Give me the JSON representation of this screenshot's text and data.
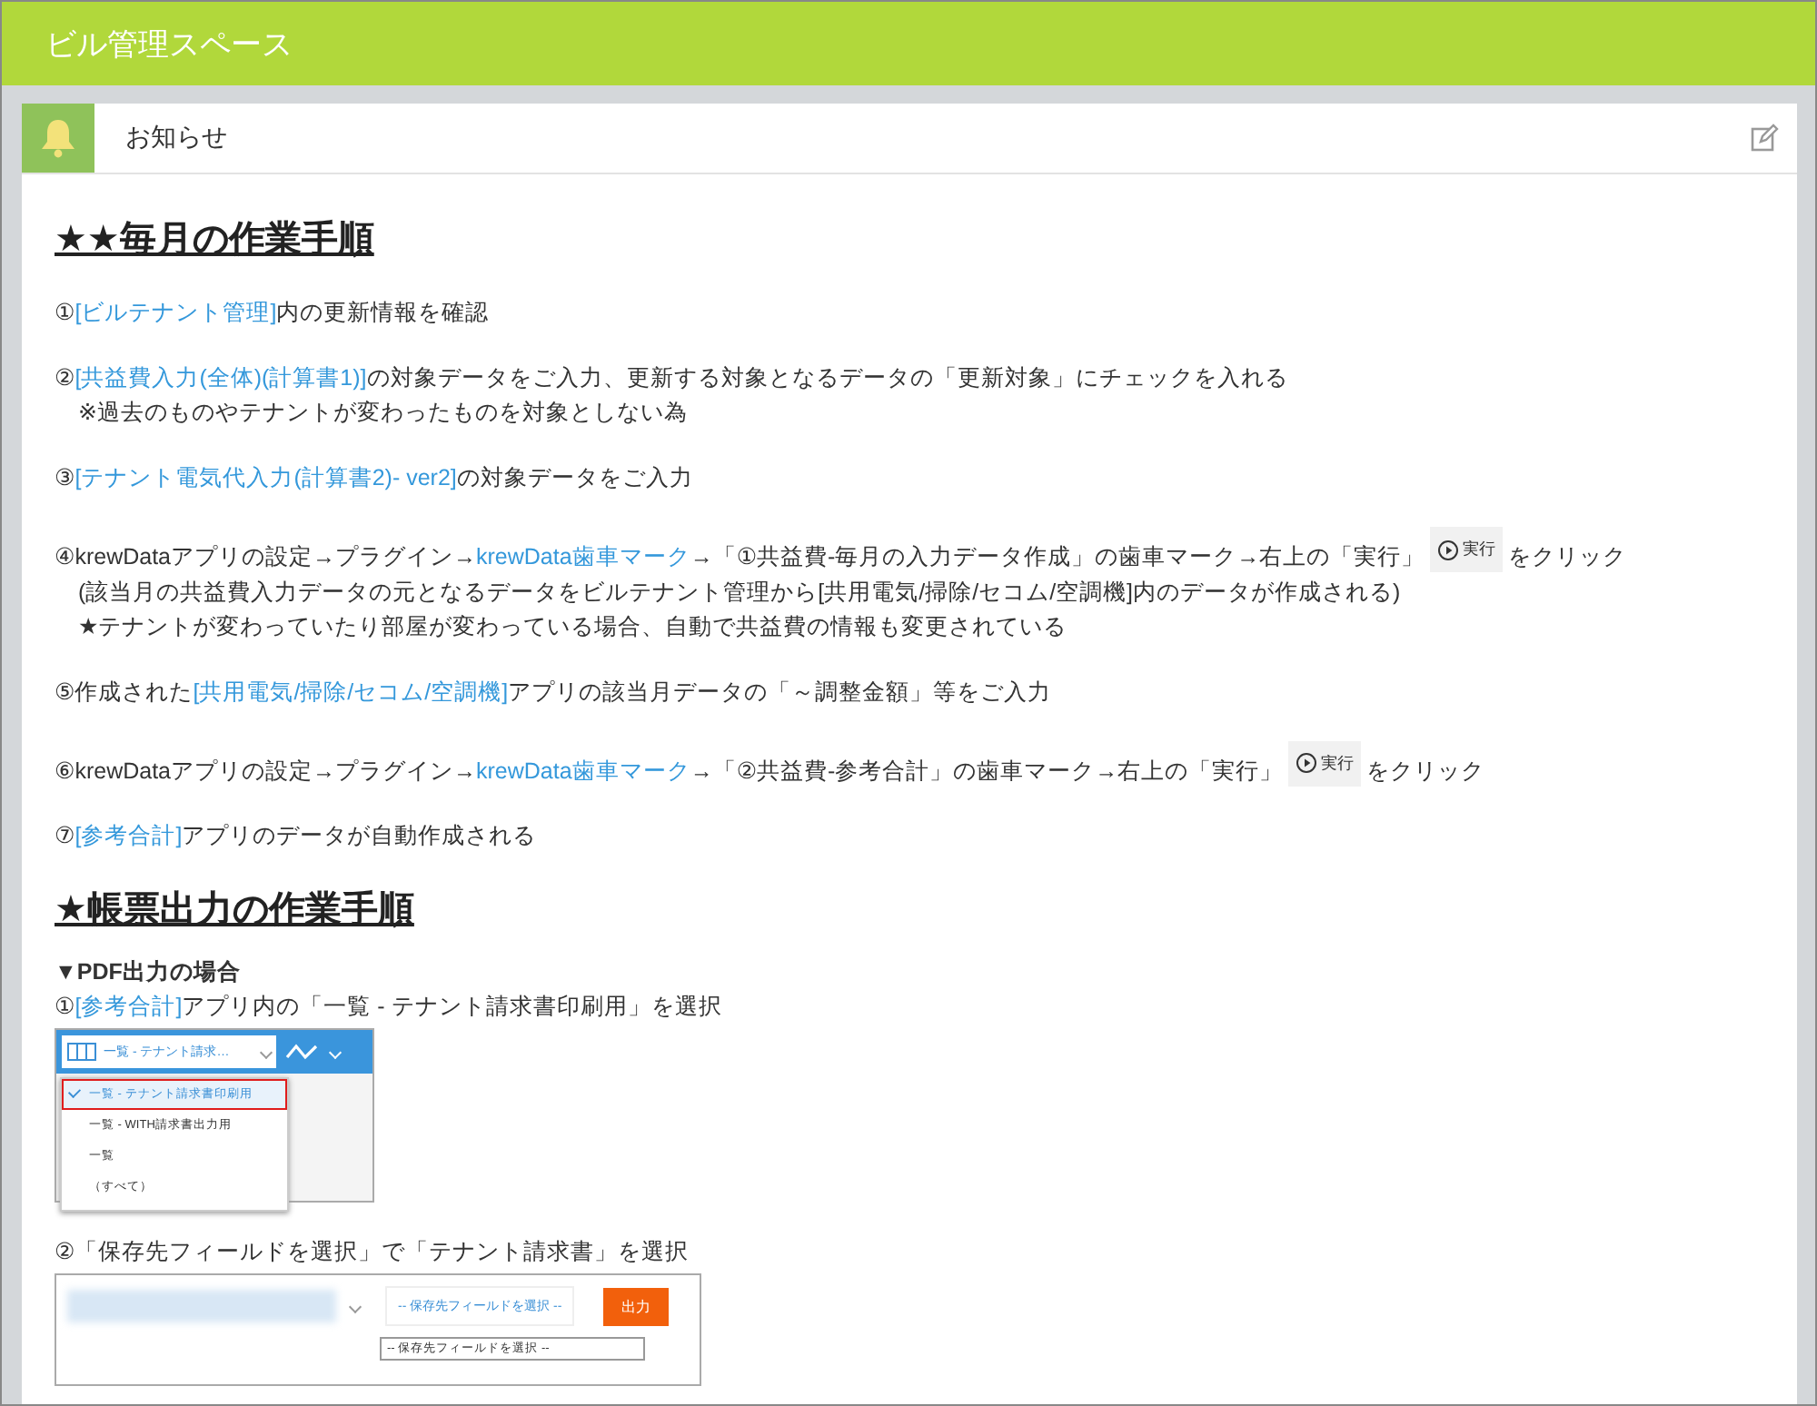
{
  "header": {
    "title": "ビル管理スペース"
  },
  "panel": {
    "title": "お知らせ"
  },
  "sections": [
    {
      "heading": "★★毎月の作業手順",
      "steps": [
        {
          "lines": [
            [
              {
                "kind": "text",
                "text": "①"
              },
              {
                "kind": "link",
                "text": "[ビルテナント管理]"
              },
              {
                "kind": "text",
                "text": "内の更新情報を確認"
              }
            ]
          ]
        },
        {
          "lines": [
            [
              {
                "kind": "text",
                "text": "②"
              },
              {
                "kind": "link",
                "text": "[共益費入力(全体)(計算書1)]"
              },
              {
                "kind": "text",
                "text": "の対象データをご入力、更新する対象となるデータの「更新対象」にチェックを入れる"
              }
            ],
            [
              {
                "kind": "text",
                "text": "　※過去のものやテナントが変わったものを対象としない為"
              }
            ]
          ]
        },
        {
          "lines": [
            [
              {
                "kind": "text",
                "text": "③"
              },
              {
                "kind": "link",
                "text": "[テナント電気代入力(計算書2)- ver2]"
              },
              {
                "kind": "text",
                "text": "の対象データをご入力"
              }
            ]
          ]
        },
        {
          "lines": [
            [
              {
                "kind": "text",
                "text": "④krewDataアプリの設定→プラグイン→"
              },
              {
                "kind": "link",
                "text": "krewData歯車マーク"
              },
              {
                "kind": "text",
                "text": "→「①共益費-毎月の入力データ作成」の歯車マーク→右上の「実行」"
              },
              {
                "kind": "run",
                "text": "実行"
              },
              {
                "kind": "text",
                "text": "をクリック"
              }
            ],
            [
              {
                "kind": "text",
                "text": "　(該当月の共益費入力データの元となるデータをビルテナント管理から[共用電気/掃除/セコム/空調機]内のデータが作成される)"
              }
            ],
            [
              {
                "kind": "text",
                "text": "　★テナントが変わっていたり部屋が変わっている場合、自動で共益費の情報も変更されている"
              }
            ]
          ]
        },
        {
          "lines": [
            [
              {
                "kind": "text",
                "text": "⑤作成された"
              },
              {
                "kind": "link",
                "text": "[共用電気/掃除/セコム/空調機]"
              },
              {
                "kind": "text",
                "text": "アプリの該当月データの「～調整金額」等をご入力"
              }
            ]
          ]
        },
        {
          "lines": [
            [
              {
                "kind": "text",
                "text": "⑥krewDataアプリの設定→プラグイン→"
              },
              {
                "kind": "link",
                "text": "krewData歯車マーク"
              },
              {
                "kind": "text",
                "text": "→「②共益費-参考合計」の歯車マーク→右上の「実行」"
              },
              {
                "kind": "run",
                "text": "実行"
              },
              {
                "kind": "text",
                "text": "をクリック"
              }
            ]
          ]
        },
        {
          "lines": [
            [
              {
                "kind": "text",
                "text": "⑦"
              },
              {
                "kind": "link",
                "text": "[参考合計]"
              },
              {
                "kind": "text",
                "text": "アプリのデータが自動作成される"
              }
            ]
          ]
        }
      ]
    },
    {
      "heading": "★帳票出力の作業手順",
      "subheading": "▼PDF出力の場合",
      "steps": [
        {
          "lines": [
            [
              {
                "kind": "text",
                "text": "①"
              },
              {
                "kind": "link",
                "text": "[参考合計]"
              },
              {
                "kind": "text",
                "text": "アプリ内の「一覧 - テナント請求書印刷用」を選択"
              }
            ]
          ],
          "shot": {
            "kind": "view-menu",
            "view": "一覧 - テナント請求…",
            "options": [
              {
                "label": "一覧 - テナント請求書印刷用",
                "selected": true
              },
              {
                "label": "一覧 - WITH請求書出力用",
                "selected": false
              },
              {
                "label": "一覧",
                "selected": false
              },
              {
                "label": "（すべて）",
                "selected": false
              }
            ]
          }
        },
        {
          "lines": [
            [
              {
                "kind": "text",
                "text": "②「保存先フィールドを選択」で「テナント請求書」を選択"
              }
            ]
          ],
          "shot": {
            "kind": "output-form",
            "select": "-- 保存先フィールドを選択 --",
            "button": "出力",
            "option": "-- 保存先フィールドを選択 --"
          }
        }
      ]
    }
  ]
}
